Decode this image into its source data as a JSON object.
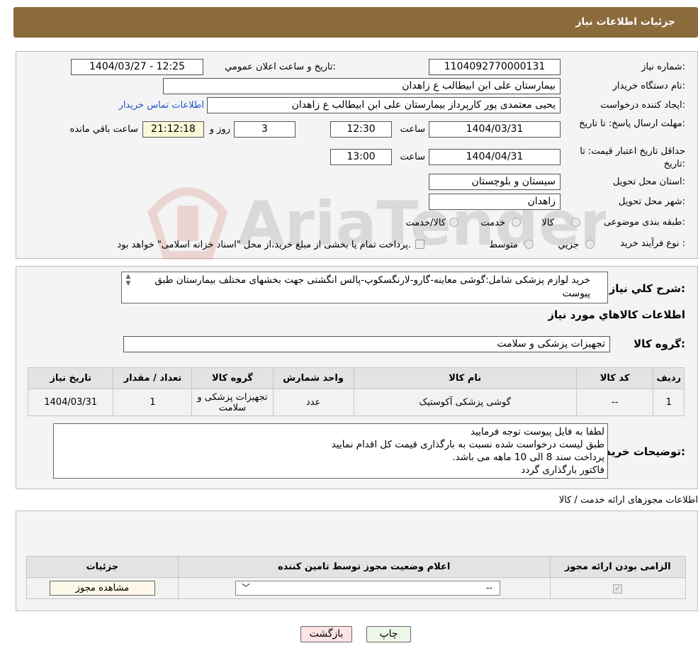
{
  "header": {
    "title": "جزئیات اطلاعات نیاز"
  },
  "watermark": {
    "text": "AriaTender.neT"
  },
  "form": {
    "need_number_label": "شماره نیاز:",
    "need_number": "1104092770000131",
    "announce_label": "تاریخ و ساعت اعلان عمومي:",
    "announce_value": "1404/03/27 - 12:25",
    "buyer_org_label": "نام دستگاه خریدار:",
    "buyer_org": "بیمارستان علی ابن ابیطالب  ع  زاهدان",
    "creator_label": "ایجاد کننده درخواست:",
    "creator": "یحیی معتمدی پور کارپرداز بیمارستان علی ابن ابیطالب  ع  زاهدان",
    "contact_link": "اطلاعات تماس خریدار",
    "deadline_label": "مهلت ارسال پاسخ: تا تاریخ:",
    "deadline_date": "1404/03/31",
    "time_label": "ساعت",
    "deadline_time": "12:30",
    "days_value": "3",
    "days_label": "روز و",
    "remaining_time": "21:12:18",
    "remaining_label": "ساعت باقي مانده",
    "validity_label": "حداقل تاریخ اعتبار قیمت: تا تاریخ:",
    "validity_date": "1404/04/31",
    "validity_time": "13:00",
    "province_label": "استان محل تحویل:",
    "province": "سیستان و بلوچستان",
    "city_label": "شهر محل تحویل:",
    "city": "زاهدان",
    "category_label": "طبقه بندی موضوعی:",
    "category_options": [
      "کالا",
      "خدمت",
      "کالا/خدمت"
    ],
    "process_label": "نوع فرآیند خرید :",
    "process_options": [
      "جزيي",
      "متوسط"
    ],
    "process_note": "پرداخت تمام یا بخشی از مبلغ خرید،از محل \"اسناد خزانه اسلامی\" خواهد بود."
  },
  "description": {
    "label": "شرح کلي نیاز:",
    "text": "خرید لوازم پزشکی شامل:گوشی معاینه-گارو-لارنگسکوپ-پالس انگشتی جهت بخشهای مختلف بیمارستان طبق پیوست"
  },
  "goods": {
    "section_title": "اطلاعات کالاهاي مورد نیاز",
    "group_label": "گروه کالا:",
    "group_value": "تجهیزات پزشکی و سلامت",
    "columns": [
      "ردیف",
      "کد کالا",
      "نام کالا",
      "واحد شمارش",
      "گروه کالا",
      "تعداد / مقدار",
      "تاریخ نیاز"
    ],
    "rows": [
      {
        "row": "1",
        "code": "--",
        "name": "گوشی پزشکی آکوستیک",
        "unit": "عدد",
        "group": "تجهیزات پزشکی و سلامت",
        "qty": "1",
        "date": "1404/03/31"
      }
    ]
  },
  "buyer_notes": {
    "label": "توضیحات خریدار:",
    "lines": [
      "لطفا به فایل پیوست توجه فرمایید",
      "طبق لیست درخواست شده نسبت به بارگذاری قیمت کل اقدام نمایید",
      "پرداخت سند 8 الی 10 ماهه می باشد.",
      "فاکتور بارگذاری گردد"
    ]
  },
  "permits": {
    "section_title": "اطلاعات مجوزهای ارائه خدمت / کالا",
    "columns": [
      "الزامی بودن ارائه مجوز",
      "اعلام وضعیت مجوز توسط تامین کننده",
      "جزئیات"
    ],
    "select_value": "--",
    "view_button": "مشاهده مجوز"
  },
  "buttons": {
    "print": "چاپ",
    "back": "بازگشت"
  },
  "colors": {
    "header": "#8b6a3c",
    "print_bg": "#eef8e8",
    "back_bg": "#fbe4e4"
  }
}
